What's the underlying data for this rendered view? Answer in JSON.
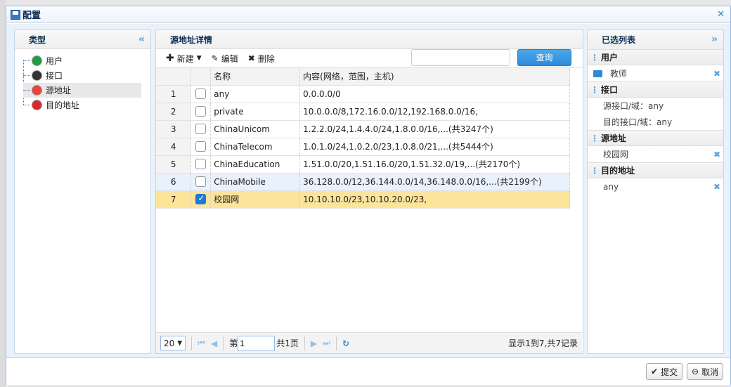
{
  "dialog": {
    "title": "配置",
    "icon": "floppy-disk-icon"
  },
  "left": {
    "title": "类型",
    "items": [
      {
        "label": "用户",
        "color": "#1e9e3e"
      },
      {
        "label": "接口",
        "color": "#333333"
      },
      {
        "label": "源地址",
        "color": "#e8463c"
      },
      {
        "label": "目的地址",
        "color": "#d9282a"
      }
    ],
    "selected": "源地址"
  },
  "middle": {
    "title": "源地址详情",
    "toolbar": {
      "new": "新建",
      "edit": "编辑",
      "delete": "删除",
      "search_placeholder": "",
      "query": "查询"
    },
    "columns": [
      "",
      "",
      "名称",
      "内容(网络，范围，主机)"
    ],
    "rows": [
      {
        "n": "1",
        "checked": false,
        "name": "any",
        "content": "0.0.0.0/0"
      },
      {
        "n": "2",
        "checked": false,
        "name": "private",
        "content": "10.0.0.0/8,172.16.0.0/12,192.168.0.0/16,"
      },
      {
        "n": "3",
        "checked": false,
        "name": "ChinaUnicom",
        "content": "1.2.2.0/24,1.4.4.0/24,1.8.0.0/16,...(共3247个)"
      },
      {
        "n": "4",
        "checked": false,
        "name": "ChinaTelecom",
        "content": "1.0.1.0/24,1.0.2.0/23,1.0.8.0/21,...(共5444个)"
      },
      {
        "n": "5",
        "checked": false,
        "name": "ChinaEducation",
        "content": "1.51.0.0/20,1.51.16.0/20,1.51.32.0/19,...(共2170个)"
      },
      {
        "n": "6",
        "checked": false,
        "name": "ChinaMobile",
        "content": "36.128.0.0/12,36.144.0.0/14,36.148.0.0/16,...(共2199个)"
      },
      {
        "n": "7",
        "checked": true,
        "name": "校园网",
        "content": "10.10.10.0/23,10.10.20.0/23,"
      }
    ],
    "pager": {
      "page_size": "20",
      "page_label": "第",
      "page": "1",
      "total_pages": "共1页",
      "summary": "显示1到7,共7记录"
    }
  },
  "right": {
    "title": "已选列表",
    "sections": [
      {
        "title": "用户",
        "items": [
          "教师"
        ]
      },
      {
        "title": "接口",
        "items": [
          "源接口/域：any",
          "目的接口/域：any"
        ]
      },
      {
        "title": "源地址",
        "items": [
          "校园网"
        ]
      },
      {
        "title": "目的地址",
        "items": [
          "any"
        ]
      }
    ]
  },
  "footer": {
    "submit": "提交",
    "cancel": "取消"
  }
}
